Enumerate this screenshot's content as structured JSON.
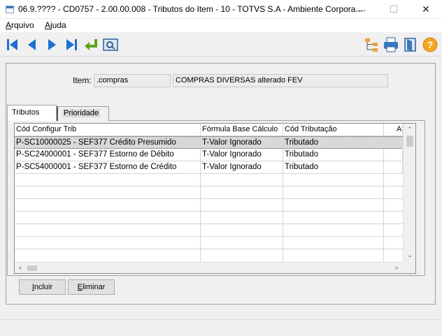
{
  "window": {
    "title": "06.9.???? - CD0757 - 2.00.00.008 - Tributos do Item - 10 - TOTVS S.A - Ambiente Corpora...",
    "minimize_icon": "minimize-icon",
    "maximize_icon": "maximize-icon",
    "close_icon": "close-icon",
    "minimize_glyph": "—",
    "maximize_glyph": "☐",
    "close_glyph": "✕"
  },
  "menu": {
    "items": [
      {
        "label_first": "A",
        "label_rest": "rquivo"
      },
      {
        "label_first": "A",
        "label_rest": "juda"
      }
    ]
  },
  "toolbar": {
    "nav_icons": [
      "first-record-icon",
      "previous-record-icon",
      "next-record-icon",
      "last-record-icon",
      "return-icon",
      "zoom-icon"
    ],
    "right_icons": [
      "tree-icon",
      "print-icon",
      "exit-icon",
      "help-icon"
    ],
    "help_glyph": "?"
  },
  "item": {
    "label": "Item:",
    "code": ".compras",
    "description": "COMPRAS DIVERSAS alterado FEV"
  },
  "tabs": [
    {
      "label": "Tributos",
      "active": true
    },
    {
      "label": "Prioridade",
      "active": false
    }
  ],
  "grid": {
    "columns": [
      "Cód Configur Trib",
      "Fórmula Base Cálculo",
      "Cód Tributação",
      "Al"
    ],
    "rows": [
      [
        "P-SC10000025 - SEF377 Crédito Presumido",
        "T-Valor Ignorado",
        "Tributado",
        ""
      ],
      [
        "P-SC24000001 - SEF377 Estorno de Débito",
        "T-Valor Ignorado",
        "Tributado",
        ""
      ],
      [
        "P-SC54000001 - SEF377 Estorno de Crédito",
        "T-Valor Ignorado",
        "Tributado",
        ""
      ]
    ],
    "selected_row": 0,
    "scroll_up_glyph": "⌃",
    "scroll_down_glyph": "⌄",
    "scroll_left_glyph": "<",
    "scroll_right_glyph": ">"
  },
  "buttons": {
    "include_first": "I",
    "include_rest": "ncluir",
    "remove_first": "E",
    "remove_rest": "liminar"
  }
}
